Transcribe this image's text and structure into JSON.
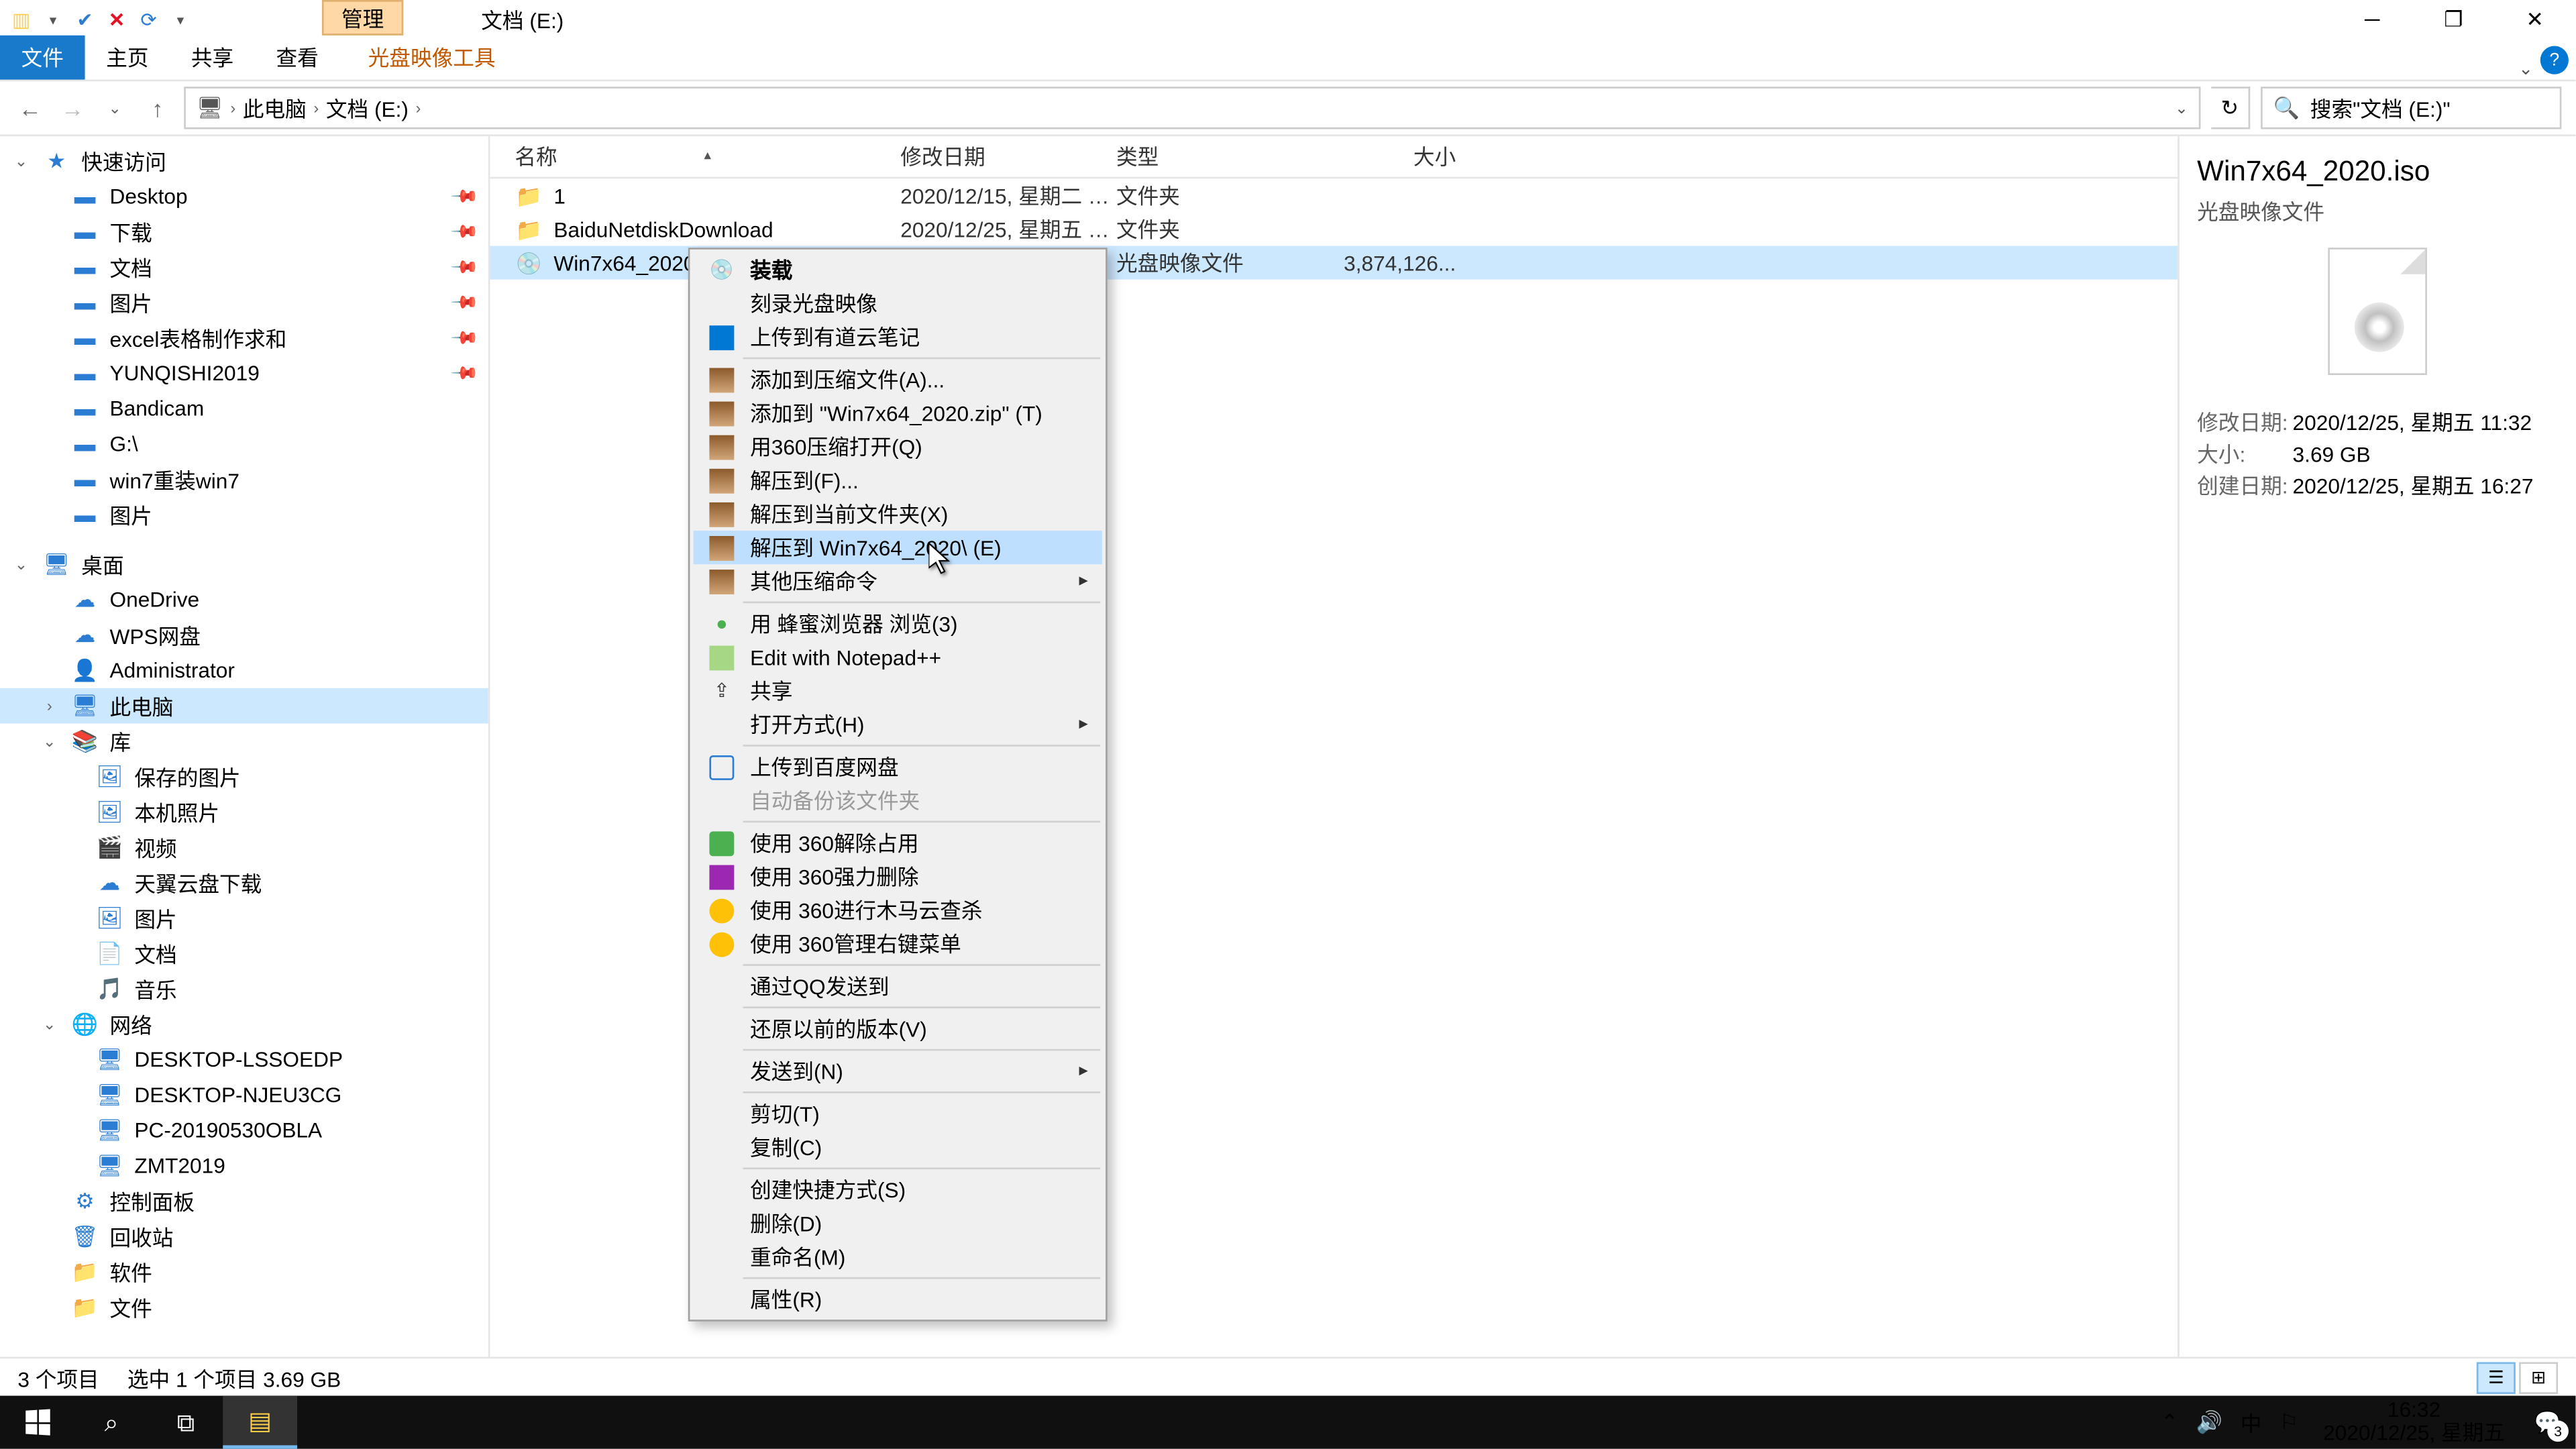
{
  "title_bar": {
    "app_title": "文档 (E:)",
    "context_tab": "管理"
  },
  "ribbon": {
    "file": "文件",
    "home": "主页",
    "share": "共享",
    "view": "查看",
    "ctx_tool": "光盘映像工具"
  },
  "addr": {
    "this_pc": "此电脑",
    "drive": "文档 (E:)"
  },
  "search": {
    "placeholder": "搜索\"文档 (E:)\""
  },
  "nav": {
    "quick": "快速访问",
    "q_items": [
      "Desktop",
      "下载",
      "文档",
      "图片",
      "excel表格制作求和",
      "YUNQISHI2019",
      "Bandicam",
      "G:\\",
      "win7重装win7",
      "图片"
    ],
    "desktop": "桌面",
    "d_items": [
      "OneDrive",
      "WPS网盘",
      "Administrator",
      "此电脑",
      "库",
      "保存的图片",
      "本机照片",
      "视频",
      "天翼云盘下载",
      "图片",
      "文档",
      "音乐",
      "网络",
      "DESKTOP-LSSOEDP",
      "DESKTOP-NJEU3CG",
      "PC-20190530OBLA",
      "ZMT2019",
      "控制面板",
      "回收站",
      "软件",
      "文件"
    ]
  },
  "cols": {
    "name": "名称",
    "date": "修改日期",
    "type": "类型",
    "size": "大小"
  },
  "files": [
    {
      "name": "1",
      "date": "2020/12/15, 星期二 1...",
      "type": "文件夹",
      "size": ""
    },
    {
      "name": "BaiduNetdiskDownload",
      "date": "2020/12/25, 星期五 1...",
      "type": "文件夹",
      "size": ""
    },
    {
      "name": "Win7x64_2020.iso",
      "date": "2020/12/25, 星期五 1...",
      "type": "光盘映像文件",
      "size": "3,874,126..."
    }
  ],
  "ctx": [
    {
      "t": "装载",
      "ico": "disc",
      "bold": true
    },
    {
      "t": "刻录光盘映像"
    },
    {
      "t": "上传到有道云笔记",
      "ico": "note"
    },
    {
      "sep": true
    },
    {
      "t": "添加到压缩文件(A)...",
      "ico": "zip"
    },
    {
      "t": "添加到 \"Win7x64_2020.zip\" (T)",
      "ico": "zip"
    },
    {
      "t": "用360压缩打开(Q)",
      "ico": "zip"
    },
    {
      "t": "解压到(F)...",
      "ico": "zip"
    },
    {
      "t": "解压到当前文件夹(X)",
      "ico": "zip"
    },
    {
      "t": "解压到 Win7x64_2020\\ (E)",
      "ico": "zip",
      "hov": true
    },
    {
      "t": "其他压缩命令",
      "ico": "zip",
      "sub": true
    },
    {
      "sep": true
    },
    {
      "t": "用 蜂蜜浏览器 浏览(3)",
      "ico": "dot"
    },
    {
      "t": "Edit with Notepad++",
      "ico": "np"
    },
    {
      "t": "共享",
      "ico": "share"
    },
    {
      "t": "打开方式(H)",
      "sub": true
    },
    {
      "sep": true
    },
    {
      "t": "上传到百度网盘",
      "ico": "baidu"
    },
    {
      "t": "自动备份该文件夹",
      "dis": true
    },
    {
      "sep": true
    },
    {
      "t": "使用 360解除占用",
      "ico": "360"
    },
    {
      "t": "使用 360强力删除",
      "ico": "360p"
    },
    {
      "t": "使用 360进行木马云查杀",
      "ico": "360y"
    },
    {
      "t": "使用 360管理右键菜单",
      "ico": "360y"
    },
    {
      "sep": true
    },
    {
      "t": "通过QQ发送到"
    },
    {
      "sep": true
    },
    {
      "t": "还原以前的版本(V)"
    },
    {
      "sep": true
    },
    {
      "t": "发送到(N)",
      "sub": true
    },
    {
      "sep": true
    },
    {
      "t": "剪切(T)"
    },
    {
      "t": "复制(C)"
    },
    {
      "sep": true
    },
    {
      "t": "创建快捷方式(S)"
    },
    {
      "t": "删除(D)"
    },
    {
      "t": "重命名(M)"
    },
    {
      "sep": true
    },
    {
      "t": "属性(R)"
    }
  ],
  "preview": {
    "title": "Win7x64_2020.iso",
    "sub": "光盘映像文件",
    "m1_lbl": "修改日期:",
    "m1_val": "2020/12/25, 星期五 11:32",
    "m2_lbl": "大小:",
    "m2_val": "3.69 GB",
    "m3_lbl": "创建日期:",
    "m3_val": "2020/12/25, 星期五 16:27"
  },
  "status": {
    "items": "3 个项目",
    "sel": "选中 1 个项目  3.69 GB"
  },
  "taskbar": {
    "time": "16:32",
    "date": "2020/12/25, 星期五",
    "ime": "中",
    "notif": "3"
  }
}
